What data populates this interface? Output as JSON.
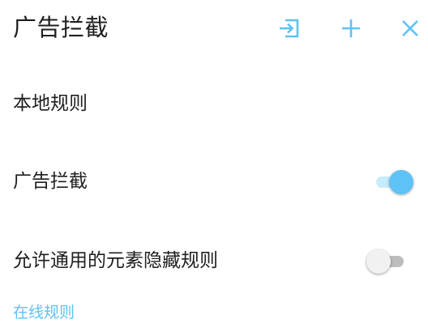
{
  "header": {
    "title": "广告拦截",
    "import_icon": "import-icon",
    "add_icon": "plus-icon",
    "close_icon": "close-icon"
  },
  "local_rules": {
    "section_title": "本地规则",
    "items": [
      {
        "label": "广告拦截",
        "enabled": true
      },
      {
        "label": "允许通用的元素隐藏规则",
        "enabled": false
      }
    ]
  },
  "online_rules": {
    "link_label": "在线规则"
  },
  "colors": {
    "accent": "#5ec2f6",
    "accent_track": "#c6ecfb",
    "text": "#1f1f1f",
    "switch_off_track": "#bdbdbd",
    "switch_off_thumb": "#f1f1f1"
  }
}
